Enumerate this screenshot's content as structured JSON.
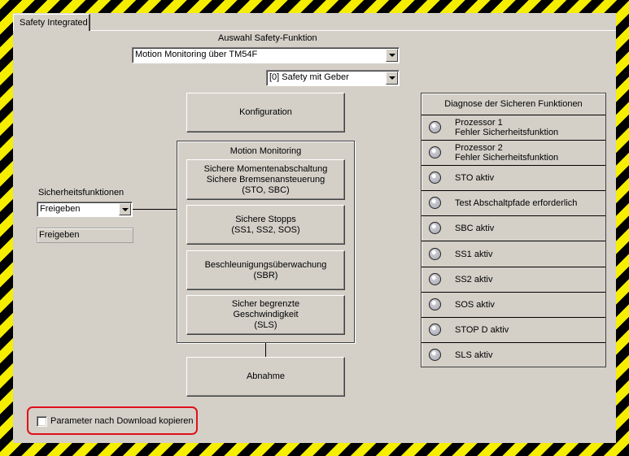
{
  "window": {
    "tab_label": "Safety Integrated"
  },
  "selection": {
    "heading": "Auswahl Safety-Funktion",
    "function_select_value": "Motion Monitoring über TM54F",
    "mode_select_value": "[0] Safety mit Geber"
  },
  "safety_functions": {
    "label": "Sicherheitsfunktionen",
    "select_value": "Freigeben",
    "status_value": "Freigeben"
  },
  "buttons": {
    "configuration": "Konfiguration",
    "acceptance": "Abnahme"
  },
  "motion_monitoring": {
    "title": "Motion Monitoring",
    "buttons": [
      {
        "label": "Sichere Momentenabschaltung\nSichere Bremsenansteuerung\n(STO, SBC)"
      },
      {
        "label": "Sichere Stopps\n(SS1, SS2, SOS)"
      },
      {
        "label": "Beschleunigungsüberwachung\n(SBR)"
      },
      {
        "label": "Sicher begrenzte\nGeschwindigkeit\n(SLS)"
      }
    ]
  },
  "diagnostics": {
    "title": "Diagnose der Sicheren Funktionen",
    "rows": [
      {
        "label": "Prozessor 1\nFehler Sicherheitsfunktion",
        "state": "off"
      },
      {
        "label": "Prozessor 2\nFehler Sicherheitsfunktion",
        "state": "off"
      },
      {
        "label": "STO aktiv",
        "state": "off"
      },
      {
        "label": "Test Abschaltpfade erforderlich",
        "state": "off"
      },
      {
        "label": "SBC aktiv",
        "state": "off"
      },
      {
        "label": "SS1 aktiv",
        "state": "off"
      },
      {
        "label": "SS2 aktiv",
        "state": "off"
      },
      {
        "label": "SOS aktiv",
        "state": "off"
      },
      {
        "label": "STOP D aktiv",
        "state": "off"
      },
      {
        "label": "SLS aktiv",
        "state": "off"
      }
    ]
  },
  "copy_params": {
    "label": "Parameter nach Download kopieren",
    "checked": false
  },
  "colors": {
    "stripe_yellow": "#f5ee00",
    "stripe_black": "#000000",
    "highlight_red": "#e0101a",
    "panel_gray": "#d4d0c8"
  }
}
